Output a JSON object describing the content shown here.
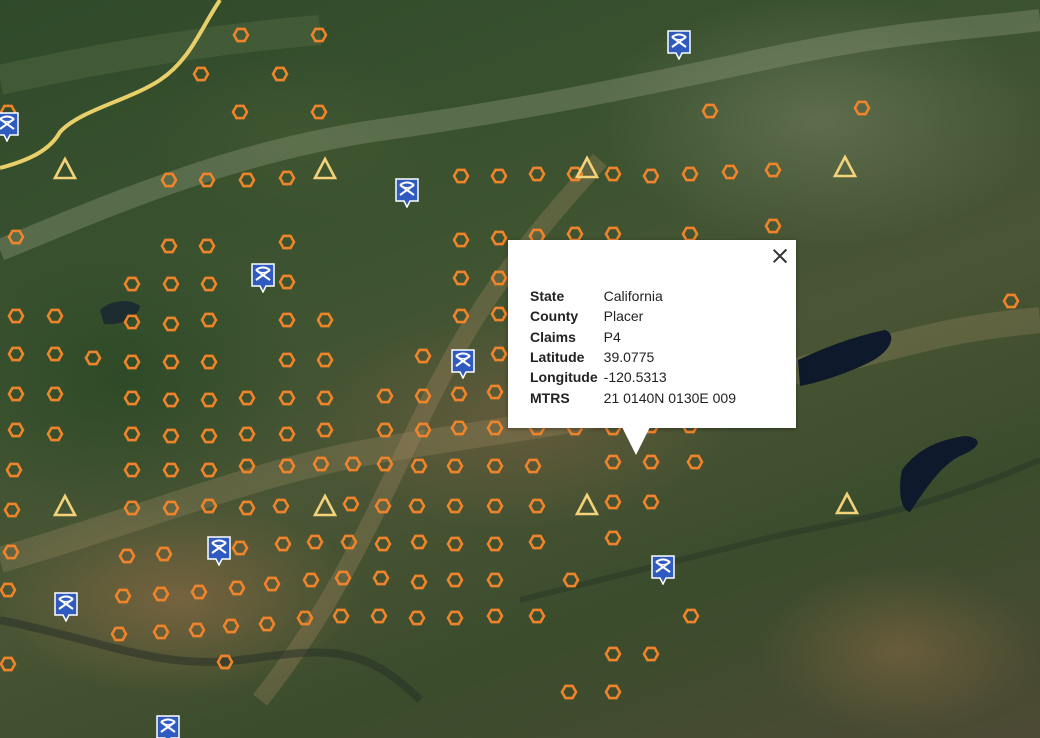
{
  "popup": {
    "fields": [
      {
        "label": "State",
        "value": "California"
      },
      {
        "label": "County",
        "value": "Placer"
      },
      {
        "label": "Claims",
        "value": "P4"
      },
      {
        "label": "Latitude",
        "value": "39.0775"
      },
      {
        "label": "Longitude",
        "value": "-120.5313"
      },
      {
        "label": "MTRS",
        "value": "21 0140N 0130E 009"
      }
    ]
  },
  "colors": {
    "claim_marker": "#f0842a",
    "triangle_marker": "#f3d27a",
    "mine_marker": "#2f5bc0",
    "road": "#e8cf6a",
    "lake": "#0e1a2c"
  },
  "icons": [
    "hexagon-claim-marker",
    "triangle-marker",
    "pickaxe-mine-icon",
    "close-icon"
  ]
}
